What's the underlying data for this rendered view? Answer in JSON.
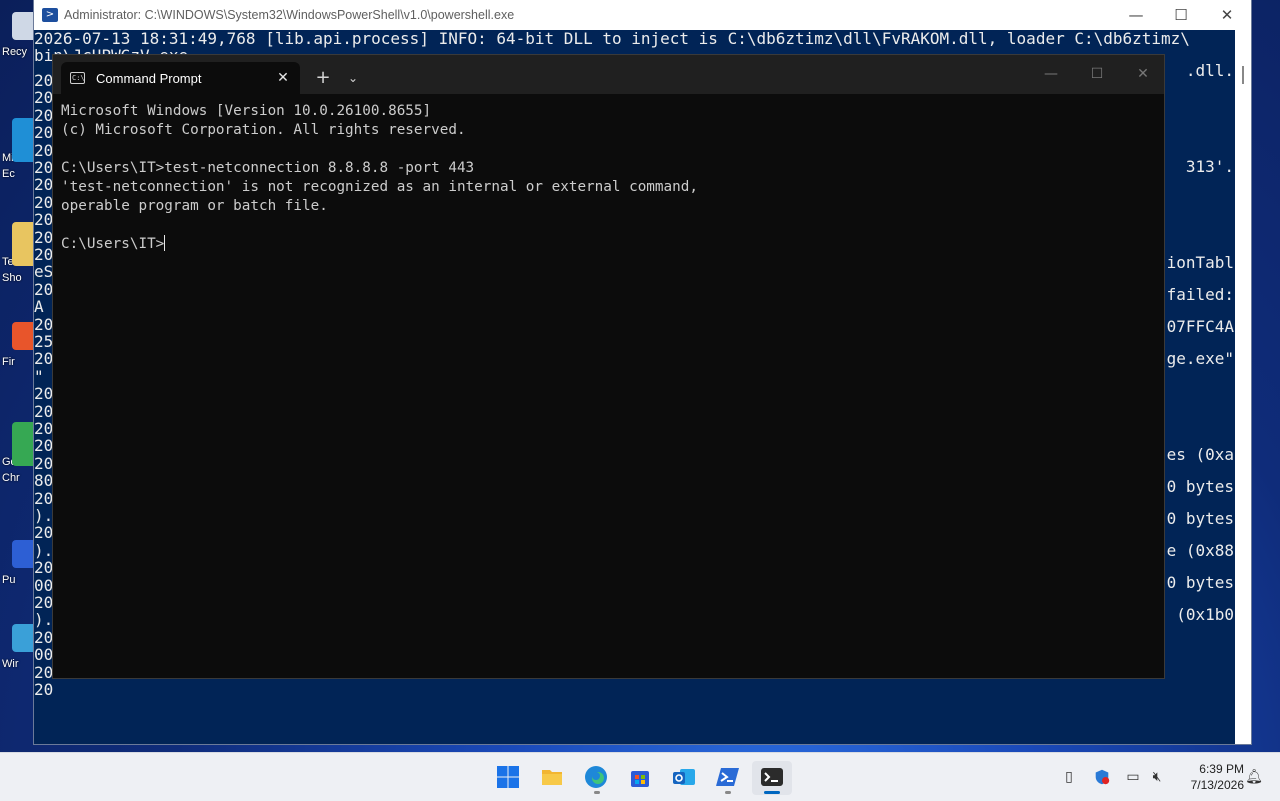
{
  "powershell": {
    "title": "Administrator: C:\\WINDOWS\\System32\\WindowsPowerShell\\v1.0\\powershell.exe",
    "lines": [
      "2026-07-13 18:31:49,768 [lib.api.process] INFO: 64-bit DLL to inject is C:\\db6ztimz\\dll\\FvRAKOM.dll, loader C:\\db6ztimz\\",
      "bin\\JcUPWGzV.exe"
    ],
    "right_fragments": [
      ".dll.",
      "313'.",
      "ionTabl",
      "failed:",
      "07FFC4A",
      "ge.exe\"",
      "es (0xa",
      "0 bytes",
      "0 bytes",
      "e (0x88",
      "0 bytes",
      "(0x1b0"
    ],
    "left_fragments": [
      "20",
      "20",
      "20",
      "20",
      "20",
      "20",
      "20",
      "20",
      "20",
      "20",
      "20",
      "eS",
      "20",
      "A",
      "20",
      "25",
      "20",
      "\"",
      "20",
      "20",
      "20",
      "20",
      "20",
      "80",
      "20",
      ").",
      "20",
      ").",
      "20",
      "00",
      "20",
      ").",
      "20",
      "00",
      "20",
      "20"
    ]
  },
  "desktop_icons": [
    {
      "label": "Recy",
      "color": "#cfd8e6"
    },
    {
      "label": "Micr",
      "color": "#1f8fd6"
    },
    {
      "label": "Ec",
      "color": "#1f8fd6"
    },
    {
      "label": "Ter",
      "color": "#e8c560"
    },
    {
      "label": "Sho",
      "color": "#e8c560"
    },
    {
      "label": "Fir",
      "color": "#e8552b"
    },
    {
      "label": "Go",
      "color": "#36a853"
    },
    {
      "label": "Chr",
      "color": "#36a853"
    },
    {
      "label": "Pu",
      "color": "#2d5fd4"
    },
    {
      "label": "Wir",
      "color": "#3aa0d8"
    }
  ],
  "terminal": {
    "tab_label": "Command Prompt",
    "tab_close": "✕",
    "new_tab": "+",
    "dropdown": "⌄",
    "minimize": "—",
    "maximize": "☐",
    "close": "✕",
    "lines": [
      "Microsoft Windows [Version 10.0.26100.8655]",
      "(c) Microsoft Corporation. All rights reserved.",
      "",
      "C:\\Users\\IT>test-netconnection 8.8.8.8 -port 443",
      "'test-netconnection' is not recognized as an internal or external command,",
      "operable program or batch file.",
      ""
    ],
    "prompt": "C:\\Users\\IT>"
  },
  "taskbar": {
    "time": "6:39 PM",
    "date": "7/13/2026",
    "apps": [
      {
        "name": "start",
        "color": "#1a73e8"
      },
      {
        "name": "file-explorer",
        "color": "#f2b632"
      },
      {
        "name": "edge",
        "color": "#1e88d8"
      },
      {
        "name": "store",
        "color": "#2a5bd7"
      },
      {
        "name": "outlook",
        "color": "#1565c0"
      },
      {
        "name": "powershell",
        "color": "#2a6bd6"
      },
      {
        "name": "terminal",
        "color": "#2b2b2b"
      }
    ],
    "accent": "#0067c0"
  }
}
